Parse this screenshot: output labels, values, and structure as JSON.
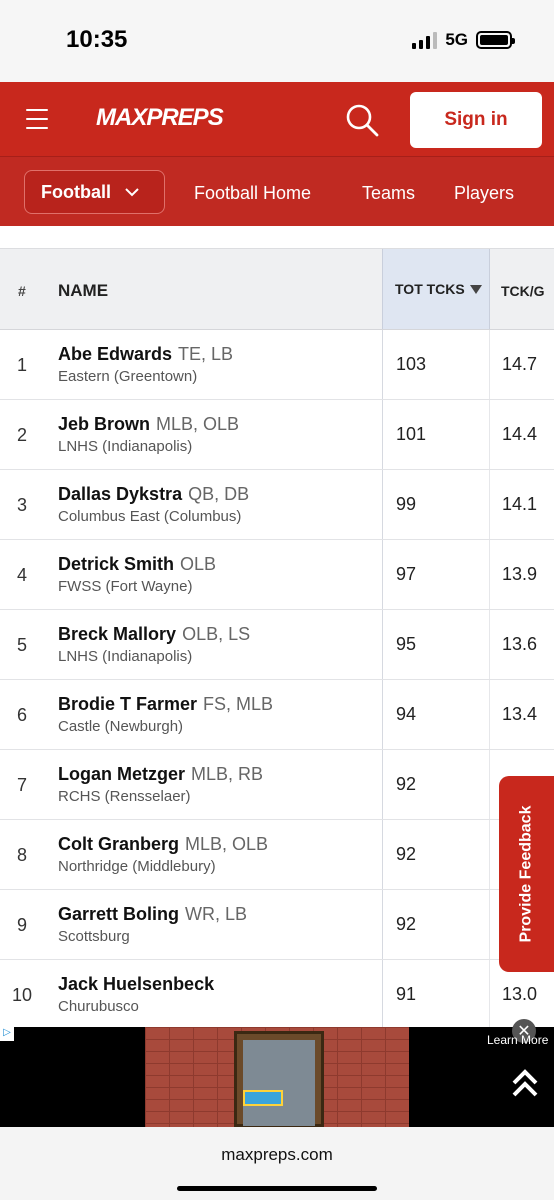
{
  "status": {
    "time": "10:35",
    "network": "5G"
  },
  "header": {
    "logo": "MAXPREPS",
    "signin_label": "Sign in"
  },
  "subnav": {
    "sport": "Football",
    "links": [
      "Football Home",
      "Teams",
      "Players"
    ]
  },
  "table": {
    "headers": {
      "rank": "#",
      "name": "NAME",
      "tot": "TOT TCKS",
      "tckg": "TCK/G"
    },
    "rows": [
      {
        "rank": "1",
        "name": "Abe Edwards",
        "pos": "TE, LB",
        "school": "Eastern (Greentown)",
        "tot": "103",
        "tckg": "14.7"
      },
      {
        "rank": "2",
        "name": "Jeb Brown",
        "pos": "MLB, OLB",
        "school": "LNHS (Indianapolis)",
        "tot": "101",
        "tckg": "14.4"
      },
      {
        "rank": "3",
        "name": "Dallas Dykstra",
        "pos": "QB, DB",
        "school": "Columbus East (Columbus)",
        "tot": "99",
        "tckg": "14.1"
      },
      {
        "rank": "4",
        "name": "Detrick Smith",
        "pos": "OLB",
        "school": "FWSS (Fort Wayne)",
        "tot": "97",
        "tckg": "13.9"
      },
      {
        "rank": "5",
        "name": "Breck Mallory",
        "pos": "OLB, LS",
        "school": "LNHS (Indianapolis)",
        "tot": "95",
        "tckg": "13.6"
      },
      {
        "rank": "6",
        "name": "Brodie T Farmer",
        "pos": "FS, MLB",
        "school": "Castle (Newburgh)",
        "tot": "94",
        "tckg": "13.4"
      },
      {
        "rank": "7",
        "name": "Logan Metzger",
        "pos": "MLB, RB",
        "school": "RCHS (Rensselaer)",
        "tot": "92",
        "tckg": ""
      },
      {
        "rank": "8",
        "name": "Colt Granberg",
        "pos": "MLB, OLB",
        "school": "Northridge (Middlebury)",
        "tot": "92",
        "tckg": ""
      },
      {
        "rank": "9",
        "name": "Garrett Boling",
        "pos": "WR, LB",
        "school": "Scottsburg",
        "tot": "92",
        "tckg": ""
      },
      {
        "rank": "10",
        "name": "Jack Huelsenbeck",
        "pos": "",
        "school": "Churubusco",
        "tot": "91",
        "tckg": "13.0"
      }
    ]
  },
  "feedback_label": "Provide Feedback",
  "ad": {
    "learn_more": "Learn More",
    "close": "✕"
  },
  "url": "maxpreps.com"
}
